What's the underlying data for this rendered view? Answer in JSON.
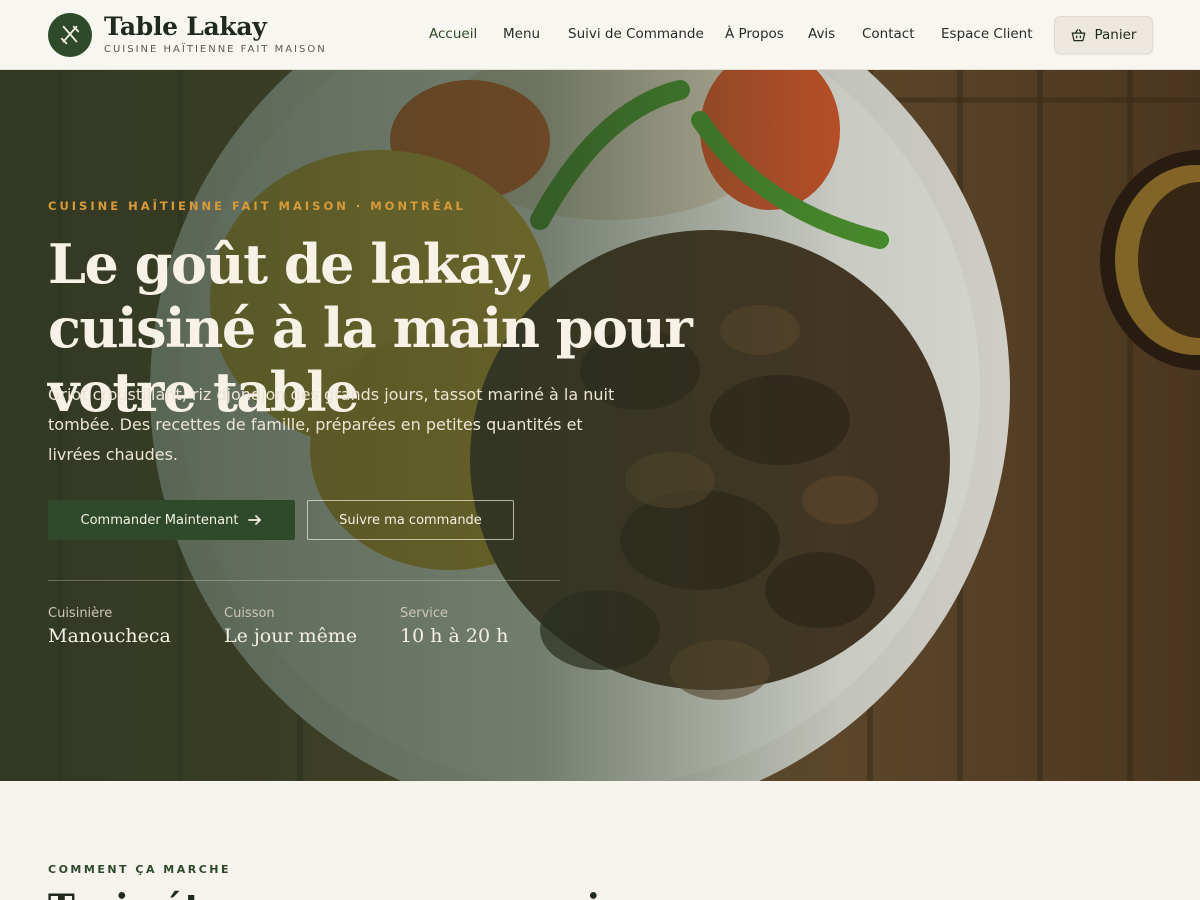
{
  "brand": {
    "name": "Table Lakay",
    "tagline": "CUISINE HAÏTIENNE FAIT MAISON",
    "logo_icon": "utensils-icon"
  },
  "nav": {
    "items": [
      {
        "label": "Accueil",
        "active": true
      },
      {
        "label": "Menu"
      },
      {
        "label": "Suivi de Commande"
      },
      {
        "label": "À Propos"
      },
      {
        "label": "Avis"
      },
      {
        "label": "Contact"
      },
      {
        "label": "Espace Client"
      }
    ],
    "cart": {
      "label": "Panier",
      "icon": "basket-icon"
    }
  },
  "hero": {
    "eyebrow": "CUISINE HAÏTIENNE FAIT MAISON · MONTRÉAL",
    "headline": "Le goût de lakay, cuisiné à la main pour votre table",
    "lede": "Griot croustillant, riz djondjon des grands jours, tassot mariné à la nuit tombée. Des recettes de famille, préparées en petites quantités et livrées chaudes.",
    "primary_cta": "Commander Maintenant",
    "secondary_cta": "Suivre ma commande",
    "stats": [
      {
        "label": "Cuisinière",
        "value": "Manoucheca"
      },
      {
        "label": "Cuisson",
        "value": "Le jour même"
      },
      {
        "label": "Service",
        "value": "10 h à 20 h"
      }
    ]
  },
  "how_it_works": {
    "eyebrow": "COMMENT ÇA MARCHE",
    "title": "Trois étapes, aucune surprise"
  },
  "colors": {
    "brand_green": "#2f4a2a",
    "accent_gold": "#d99a3a",
    "page_bg": "#f7f4ee"
  }
}
